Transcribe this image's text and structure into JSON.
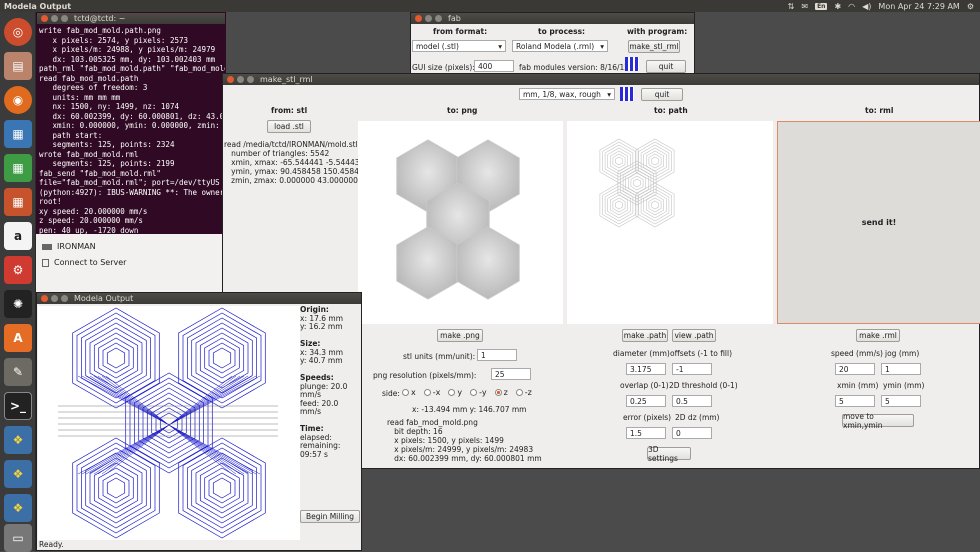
{
  "top_panel": {
    "app_title": "Modela Output",
    "clock": "Mon Apr 24  7:29 AM",
    "keyboard": "En"
  },
  "terminal": {
    "title": "tctd@tctd: ~",
    "lines": [
      "write fab_mod_mold.path.png",
      "   x pixels: 2574, y pixels: 2573",
      "   x pixels/m: 24988, y pixels/m: 24979",
      "   dx: 103.005325 mm, dy: 103.002403 mm",
      "path_rml \"fab_mod_mold.path\" \"fab_mod_mold.rml\" 20 5 5 -43.0 1",
      "read fab_mod_mold.path",
      "   degrees of freedom: 3",
      "   units: mm mm mm",
      "   nx: 1500, ny: 1499, nz: 1074",
      "   dx: 60.002399, dy: 60.000801, dz: 43.0",
      "   xmin: 0.000000, ymin: 0.000000, zmin:",
      "   path start:",
      "   segments: 125, points: 2324",
      "wrote fab_mod_mold.rml",
      "   segments: 125, points: 2199",
      "fab_send \"fab_mod_mold.rml\"",
      "file=\"fab_mod_mold.rml\"; port=/dev/ttyUS",
      "",
      "(python:4927): IBUS-WARNING **: The owner",
      "root!",
      "xy speed: 20.000000 mm/s",
      "z speed: 20.000000 mm/s",
      "pen: 40 up, -1720 down"
    ]
  },
  "fab": {
    "title": "fab",
    "from_format_label": "from format:",
    "to_process_label": "to process:",
    "with_program_label": "with program:",
    "format_value": "model (.stl)",
    "process_value": "Roland Modela (.rml)",
    "program_button": "make_stl_rml",
    "gui_size_label": "GUI size (pixels):",
    "gui_size_value": "400",
    "version": "fab modules version: 8/16/12",
    "quit": "quit"
  },
  "stl_window": {
    "title": "make_stl_rml",
    "process_select": "mm, 1/8, wax, rough",
    "quit": "quit",
    "headers": {
      "from_stl": "from: stl",
      "to_png": "to: png",
      "to_path": "to: path",
      "to_rml": "to: rml"
    },
    "load_stl": "load .stl",
    "stl_info": [
      "read /media/tctd/IRONMAN/mold.stl",
      "   number of triangles: 5542",
      "   xmin, xmax: -65.544441 -5.544437",
      "   ymin, ymax: 90.458458 150.458450",
      "   zmin, zmax: 0.000000 43.000000"
    ],
    "send_it": "send it!",
    "make_png": "make .png",
    "stl_units_label": "stl units (mm/unit):",
    "stl_units_value": "1",
    "png_res_label": "png resolution (pixels/mm):",
    "png_res_value": "25",
    "side_label": "side:",
    "sides": [
      "x",
      "-x",
      "y",
      "-y",
      "z",
      "-z"
    ],
    "selected_side": "z",
    "cursor_readout": "x: -13.494 mm  y: 146.707 mm",
    "png_info": [
      "read fab_mod_mold.png",
      "   bit depth: 16",
      "   x pixels: 1500, y pixels: 1499",
      "   x pixels/m: 24999, y pixels/m: 24983",
      "   dx: 60.002399 mm, dy: 60.000801 mm"
    ],
    "make_path": "make .path",
    "view_path": "view .path",
    "diameter_label": "diameter (mm)",
    "diameter_value": "3.175",
    "offsets_label": "offsets (-1 to fill)",
    "offsets_value": "-1",
    "overlap_label": "overlap (0-1)",
    "overlap_value": "0.25",
    "threshold_label": "2D threshold (0-1)",
    "threshold_value": "0.5",
    "error_label": "error (pixels)",
    "error_value": "1.5",
    "dz_label": "2D dz (mm)",
    "dz_value": "0",
    "settings_3d": "3D settings",
    "make_rml": "make .rml",
    "speed_label": "speed (mm/s)",
    "speed_value": "20",
    "jog_label": "jog (mm)",
    "jog_value": "1",
    "xmin_label": "xmin (mm)",
    "xmin_value": "5",
    "ymin_label": "ymin (mm)",
    "ymin_value": "5",
    "move_to": "move to xmin,ymin"
  },
  "ironman": {
    "device": "IRONMAN",
    "connect": "Connect to Server"
  },
  "modela": {
    "title": "Modela Output",
    "origin_label": "Origin:",
    "origin_x": "x: 17.6 mm",
    "origin_y": "y: 16.2 mm",
    "size_label": "Size:",
    "size_x": "x: 34.3 mm",
    "size_y": "y: 40.7 mm",
    "speeds_label": "Speeds:",
    "plunge": "plunge: 20.0 mm/s",
    "feed": "feed: 20.0 mm/s",
    "time_label": "Time:",
    "elapsed": "elapsed:",
    "remaining": "remaining: 09:57 s",
    "begin": "Begin Milling",
    "status": "Ready."
  },
  "colors": {
    "terminal_bg": "#300a24",
    "toolpath": "#1a1acc",
    "accent": "#e25a30"
  }
}
